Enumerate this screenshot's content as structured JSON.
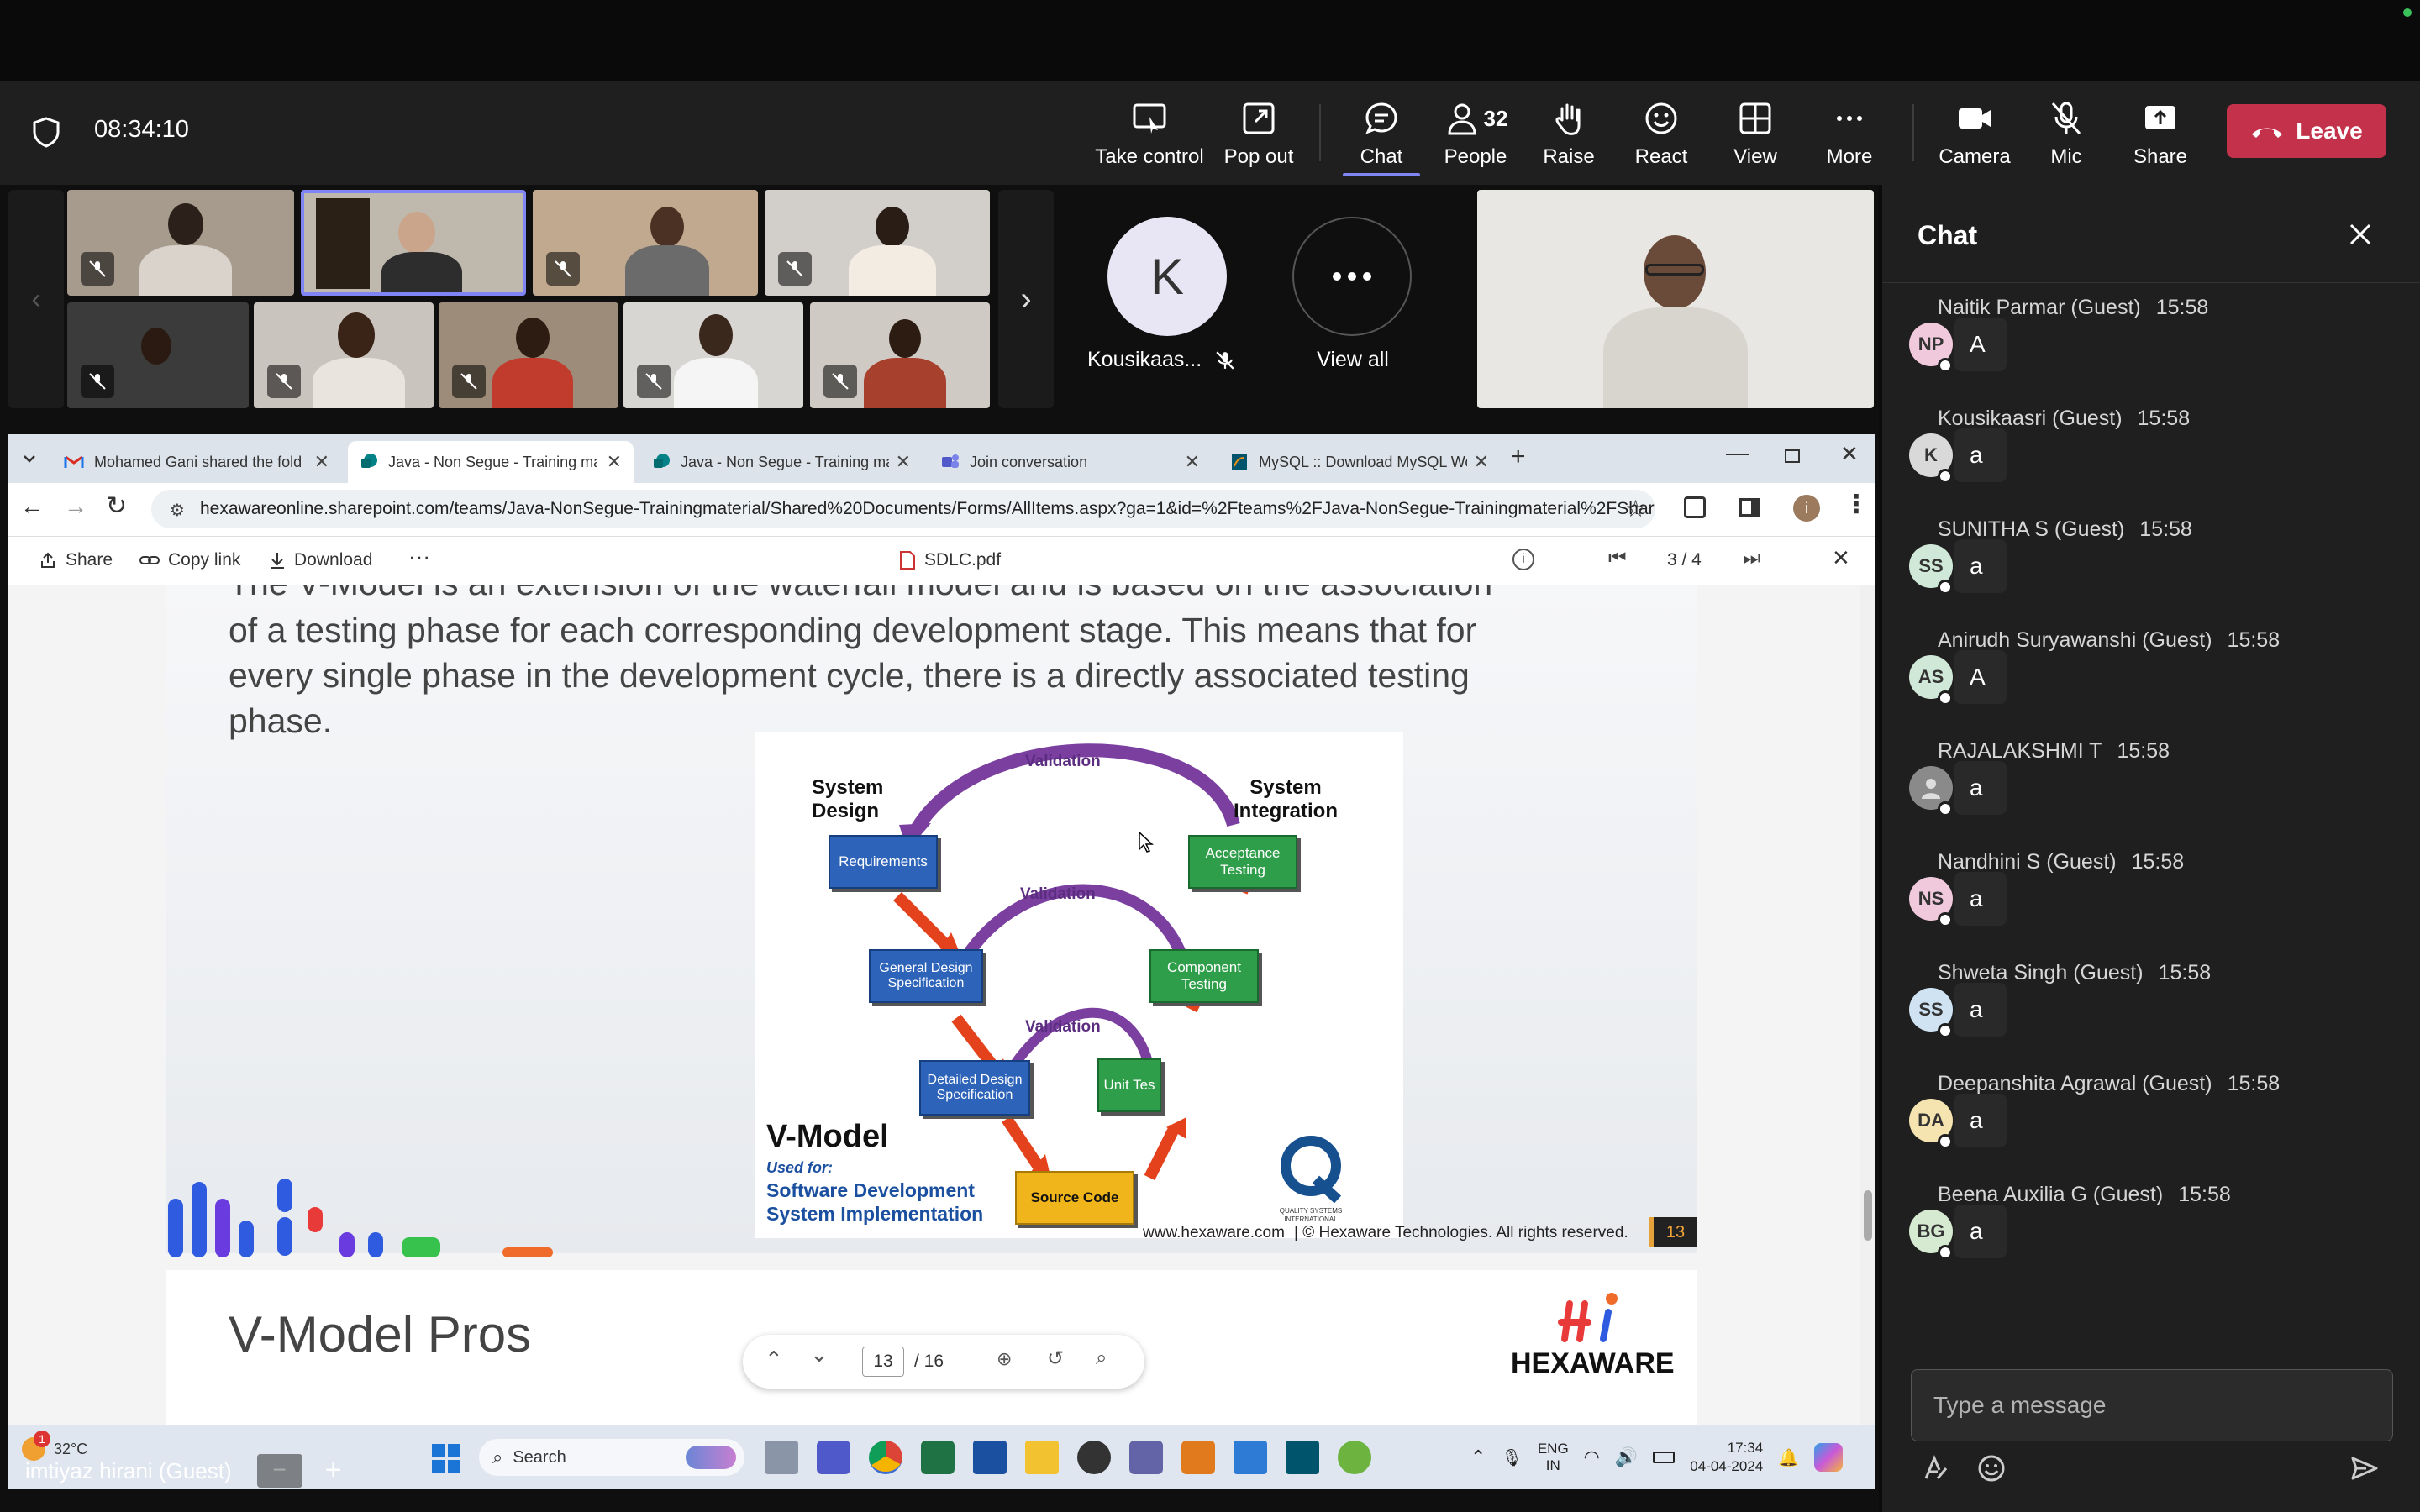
{
  "meeting": {
    "timer": "08:34:10"
  },
  "toolbar": {
    "take_control": "Take control",
    "pop_out": "Pop out",
    "chat": "Chat",
    "people": "People",
    "people_count": "32",
    "raise": "Raise",
    "react": "React",
    "view": "View",
    "more": "More",
    "camera": "Camera",
    "mic": "Mic",
    "share": "Share",
    "leave": "Leave"
  },
  "participants": {
    "k_initial": "K",
    "k_name": "Kousikaas...",
    "view_all": "View all",
    "self_name": "imtiyaz hirani (Guest)"
  },
  "chat": {
    "title": "Chat",
    "input_placeholder": "Type a message",
    "messages": [
      {
        "name": "Naitik Parmar (Guest)",
        "time": "15:58",
        "initials": "NP",
        "text": "A",
        "color": "#f1c9dc"
      },
      {
        "name": "Kousikaasri (Guest)",
        "time": "15:58",
        "initials": "K",
        "text": "a",
        "color": "#d9d9d9"
      },
      {
        "name": "SUNITHA S (Guest)",
        "time": "15:58",
        "initials": "SS",
        "text": "a",
        "color": "#cfe8d8"
      },
      {
        "name": "Anirudh Suryawanshi (Guest)",
        "time": "15:58",
        "initials": "AS",
        "text": "A",
        "color": "#cfe8d8"
      },
      {
        "name": "RAJALAKSHMI T",
        "time": "15:58",
        "initials": "",
        "text": "a",
        "color": "#8a8a8a"
      },
      {
        "name": "Nandhini S (Guest)",
        "time": "15:58",
        "initials": "NS",
        "text": "a",
        "color": "#f1c9dc"
      },
      {
        "name": "Shweta Singh (Guest)",
        "time": "15:58",
        "initials": "SS",
        "text": "a",
        "color": "#cfe3f3"
      },
      {
        "name": "Deepanshita Agrawal (Guest)",
        "time": "15:58",
        "initials": "DA",
        "text": "a",
        "color": "#f5e4b0"
      },
      {
        "name": "Beena Auxilia G (Guest)",
        "time": "15:58",
        "initials": "BG",
        "text": "a",
        "color": "#d6ead2"
      }
    ]
  },
  "browser": {
    "tabs": [
      {
        "title": "Mohamed Gani shared the fold",
        "icon": "gmail-icon"
      },
      {
        "title": "Java - Non Segue - Training ma",
        "icon": "sharepoint-icon"
      },
      {
        "title": "Java - Non Segue - Training ma",
        "icon": "sharepoint-icon"
      },
      {
        "title": "Join conversation",
        "icon": "teams-icon"
      },
      {
        "title": "MySQL :: Download MySQL Wo",
        "icon": "mysql-icon"
      }
    ],
    "url": "hexawareonline.sharepoint.com/teams/Java-NonSegue-Trainingmaterial/Shared%20Documents/Forms/AllItems.aspx?ga=1&id=%2Fteams%2FJava-NonSegue-Trainingmaterial%2FShared...",
    "profile_initial": "i"
  },
  "viewer": {
    "share": "Share",
    "copy_link": "Copy link",
    "download": "Download",
    "filename": "SDLC.pdf",
    "page_indicator": "3 / 4",
    "current_page": "13",
    "total_pages": "/ 16"
  },
  "slide": {
    "body_top": "The V-Model is an extension of the waterfall model and is based on the association",
    "body_line1": "of a testing phase for each corresponding development stage. This means that for",
    "body_line2": "every single phase in the development cycle, there is a directly associated testing",
    "body_line3": "phase.",
    "footer_site": "www.hexaware.com",
    "footer_copy": "| © Hexaware Technologies. All rights reserved.",
    "slide_number": "13",
    "next_title": "V-Model Pros",
    "logo_text": "HEXAWARE",
    "diagram": {
      "system_design": "System\nDesign",
      "system_integration": "System\nIntegration",
      "validation": "Validation",
      "requirements": "Requirements",
      "acceptance": "Acceptance\nTesting",
      "general_design": "General Design\nSpecification",
      "component": "Component\nTesting",
      "detailed_design": "Detailed Design\nSpecification",
      "unit": "Unit Tes",
      "source": "Source Code",
      "vmodel": "V-Model",
      "used_for": "Used for:",
      "sw_dev": "Software Development",
      "sys_impl": "System Implementation",
      "qsi": "QUALITY SYSTEMS\nINTERNATIONAL"
    }
  },
  "taskbar": {
    "weather": "32°C",
    "search": "Search",
    "lang1": "ENG",
    "lang2": "IN",
    "time": "17:34",
    "date": "04-04-2024",
    "badge": "1"
  }
}
